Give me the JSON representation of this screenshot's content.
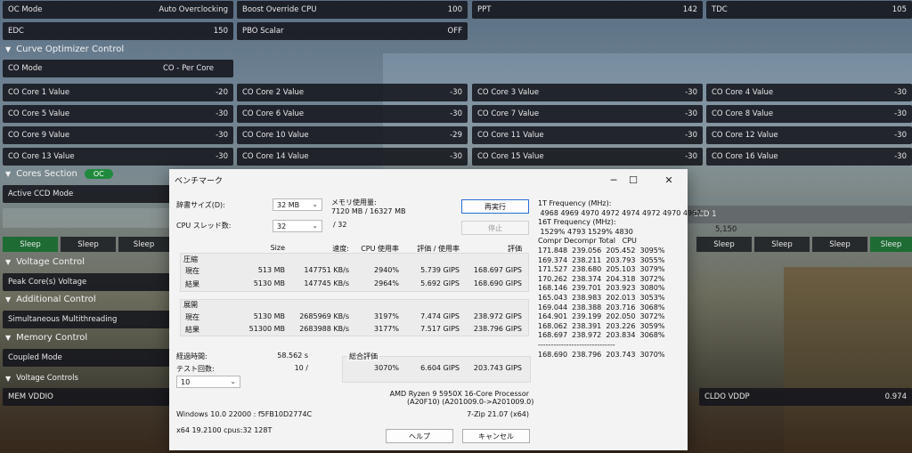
{
  "top_rows": [
    {
      "label": "OC Mode",
      "value": "Auto Overclocking"
    },
    {
      "label": "Boost Override CPU",
      "value": "100"
    },
    {
      "label": "PPT",
      "value": "142"
    },
    {
      "label": "TDC",
      "value": "105"
    },
    {
      "label": "EDC",
      "value": "150"
    },
    {
      "label": "PBO Scalar",
      "value": "OFF"
    }
  ],
  "curve_optimizer": {
    "title": "Curve Optimizer Control",
    "mode_label": "CO Mode",
    "mode_value": "CO - Per Core",
    "cores": [
      {
        "label": "CO Core 1 Value",
        "value": "-20"
      },
      {
        "label": "CO Core 2 Value",
        "value": "-30"
      },
      {
        "label": "CO Core 3 Value",
        "value": "-30"
      },
      {
        "label": "CO Core 4 Value",
        "value": "-30"
      },
      {
        "label": "CO Core 5 Value",
        "value": "-30"
      },
      {
        "label": "CO Core 6 Value",
        "value": "-30"
      },
      {
        "label": "CO Core 7 Value",
        "value": "-30"
      },
      {
        "label": "CO Core 8 Value",
        "value": "-30"
      },
      {
        "label": "CO Core 9 Value",
        "value": "-30"
      },
      {
        "label": "CO Core 10 Value",
        "value": "-29"
      },
      {
        "label": "CO Core 11 Value",
        "value": "-30"
      },
      {
        "label": "CO Core 12 Value",
        "value": "-30"
      },
      {
        "label": "CO Core 13 Value",
        "value": "-30"
      },
      {
        "label": "CO Core 14 Value",
        "value": "-30"
      },
      {
        "label": "CO Core 15 Value",
        "value": "-30"
      },
      {
        "label": "CO Core 16 Value",
        "value": "-30"
      }
    ]
  },
  "cores_section": {
    "title": "Cores Section",
    "badge": "OC",
    "active_ccd_label": "Active CCD Mode",
    "ccd1_label": "CCD 1",
    "freq": "5,150",
    "sleep_left": [
      "Sleep",
      "Sleep",
      "Sleep"
    ],
    "sleep_right": [
      "Sleep",
      "Sleep",
      "Sleep",
      "Sleep"
    ]
  },
  "voltage_control": {
    "title": "Voltage Control",
    "item": "Peak Core(s) Voltage"
  },
  "additional_control": {
    "title": "Additional Control",
    "item": "Simultaneous Multithreading"
  },
  "memory_control": {
    "title": "Memory Control",
    "item": "Coupled Mode"
  },
  "voltage_controls": {
    "title": "Voltage Controls",
    "mem_vddio": "MEM VDDIO",
    "cldo_label": "CLDO VDDP",
    "cldo_value": "0.974"
  },
  "dialog": {
    "title": "ベンチマーク",
    "dict_label": "辞書サイズ(D):",
    "dict_value": "32 MB",
    "threads_label": "CPU スレッド数:",
    "threads_value": "32",
    "threads_total": "/ 32",
    "mem_label": "メモリ使用量:",
    "mem_value": "7120 MB / 16327 MB",
    "rerun": "再実行",
    "stop": "停止",
    "headers": {
      "size": "Size",
      "speed": "速度:",
      "cpu": "CPU 使用率",
      "rating_usage": "評価 / 使用率",
      "rating": "評価"
    },
    "compress_label": "圧縮",
    "decompress_label": "展開",
    "current": "現在",
    "result": "結果",
    "compress_rows": [
      {
        "size": "513 MB",
        "speed": "147751 KB/s",
        "cpu": "2940%",
        "ru": "5.739 GIPS",
        "rating": "168.697 GIPS"
      },
      {
        "size": "5130 MB",
        "speed": "147745 KB/s",
        "cpu": "2964%",
        "ru": "5.692 GIPS",
        "rating": "168.690 GIPS"
      }
    ],
    "decompress_rows": [
      {
        "size": "5130 MB",
        "speed": "2685969 KB/s",
        "cpu": "3197%",
        "ru": "7.474 GIPS",
        "rating": "238.972 GIPS"
      },
      {
        "size": "51300 MB",
        "speed": "2683988 KB/s",
        "cpu": "3177%",
        "ru": "7.517 GIPS",
        "rating": "238.796 GIPS"
      }
    ],
    "elapsed_label": "経過時間:",
    "elapsed_value": "58.562 s",
    "tests_label": "テスト回数:",
    "tests_value": "10 /",
    "tests_select": "10",
    "total_label": "総合評価",
    "total_cpu": "3070%",
    "total_ru": "6.604 GIPS",
    "total_rating": "203.743 GIPS",
    "cpu_name": "AMD Ryzen 9 5950X 16-Core Processor",
    "cpu_id": "(A20F10) (A201009.0->A201009.0)",
    "version": "7-Zip 21.07 (x64)",
    "os": "Windows 10.0 22000 : f5FB10D2774C",
    "arch": "x64 19.2100 cpus:32 128T",
    "help": "ヘルプ",
    "cancel": "キャンセル",
    "freq_panel": "1T Frequency (MHz):\n 4968 4969 4970 4972 4974 4972 4970 4967\n16T Frequency (MHz):\n 1529% 4793 1529% 4830\nCompr Decompr Total   CPU\n171.848  239.056  205.452  3095%\n169.374  238.211  203.793  3055%\n171.527  238.680  205.103  3079%\n170.262  238.374  204.318  3072%\n168.146  239.701  203.923  3080%\n165.043  238.983  202.013  3053%\n169.044  238.388  203.716  3068%\n164.901  239.199  202.050  3072%\n168.062  238.391  203.226  3059%\n168.697  238.972  203.834  3068%\n------------------------------\n168.690  238.796  203.743  3070%"
  }
}
